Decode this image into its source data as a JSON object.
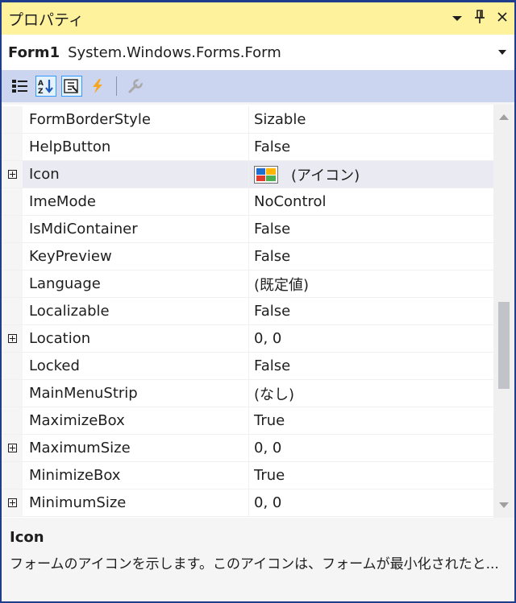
{
  "panel": {
    "title": "プロパティ",
    "buttons": {
      "dropdown": "▾",
      "pin": "ꟷ",
      "close": "×"
    }
  },
  "object_selector": {
    "name": "Form1",
    "type": "System.Windows.Forms.Form",
    "arrow": "▾"
  },
  "toolbar": {
    "tools": [
      "categorized-icon",
      "alphabetical-icon",
      "properties-icon",
      "events-icon",
      "property-pages-icon"
    ]
  },
  "properties": [
    {
      "name": "FormBorderStyle",
      "value": "Sizable",
      "expandable": false
    },
    {
      "name": "HelpButton",
      "value": "False",
      "expandable": false
    },
    {
      "name": "Icon",
      "value": "(アイコン)",
      "expandable": true,
      "selected": true,
      "has_icon": true
    },
    {
      "name": "ImeMode",
      "value": "NoControl",
      "expandable": false
    },
    {
      "name": "IsMdiContainer",
      "value": "False",
      "expandable": false
    },
    {
      "name": "KeyPreview",
      "value": "False",
      "expandable": false
    },
    {
      "name": "Language",
      "value": "(既定値)",
      "expandable": false
    },
    {
      "name": "Localizable",
      "value": "False",
      "expandable": false
    },
    {
      "name": "Location",
      "value": "0, 0",
      "expandable": true
    },
    {
      "name": "Locked",
      "value": "False",
      "expandable": false
    },
    {
      "name": "MainMenuStrip",
      "value": "(なし)",
      "expandable": false
    },
    {
      "name": "MaximizeBox",
      "value": "True",
      "expandable": false
    },
    {
      "name": "MaximumSize",
      "value": "0, 0",
      "expandable": true
    },
    {
      "name": "MinimizeBox",
      "value": "True",
      "expandable": false
    },
    {
      "name": "MinimumSize",
      "value": "0, 0",
      "expandable": true
    }
  ],
  "description": {
    "title": "Icon",
    "text": "フォームのアイコンを示します。このアイコンは、フォームが最小化されたと..."
  },
  "colors": {
    "title_bar": "#fff29d",
    "toolbar": "#ccd5f0",
    "border": "#1f3d8c",
    "selected_row": "#eaeaf2"
  }
}
